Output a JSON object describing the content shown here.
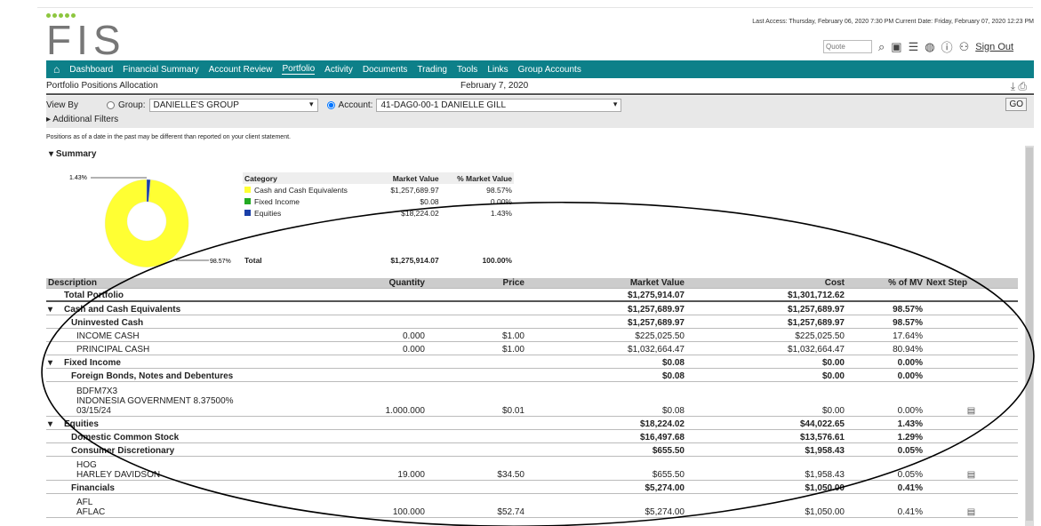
{
  "header": {
    "logo": "FIS",
    "last_access": "Last Access: Thursday, February 06, 2020 7:30 PM Current Date: Friday, February 07, 2020 12:23 PM",
    "quote_placeholder": "Quote",
    "sign_out": "Sign Out"
  },
  "nav": [
    "Dashboard",
    "Financial Summary",
    "Account Review",
    "Portfolio",
    "Activity",
    "Documents",
    "Trading",
    "Tools",
    "Links",
    "Group Accounts"
  ],
  "nav_active": "Portfolio",
  "page": {
    "title": "Portfolio Positions Allocation",
    "date": "February 7, 2020"
  },
  "filters": {
    "view_by": "View By",
    "group_label": "Group:",
    "group_value": "DANIELLE'S GROUP",
    "account_label": "Account:",
    "account_value": "41-DAG0-00-1 DANIELLE GILL",
    "go": "GO",
    "additional": "Additional Filters",
    "selected": "account"
  },
  "note": "Positions as of a date in the past may be different than reported on your client statement.",
  "summary": {
    "title": "Summary",
    "label_small": "1.43%",
    "label_large": "98.57%",
    "headers": [
      "Category",
      "Market Value",
      "% Market Value"
    ],
    "rows": [
      {
        "name": "Cash and Cash Equivalents",
        "mv": "$1,257,689.97",
        "pct": "98.57%",
        "color": "#ffff33"
      },
      {
        "name": "Fixed Income",
        "mv": "$0.08",
        "pct": "0.00%",
        "color": "#22aa22"
      },
      {
        "name": "Equities",
        "mv": "$18,224.02",
        "pct": "1.43%",
        "color": "#1a3fa8"
      }
    ],
    "total": {
      "label": "Total",
      "mv": "$1,275,914.07",
      "pct": "100.00%"
    }
  },
  "chart_data": {
    "type": "pie",
    "categories": [
      "Cash and Cash Equivalents",
      "Fixed Income",
      "Equities"
    ],
    "values": [
      98.57,
      0.0,
      1.43
    ],
    "colors": [
      "#ffff33",
      "#22aa22",
      "#1a3fa8"
    ]
  },
  "table": {
    "headers": [
      "Description",
      "Quantity",
      "Price",
      "Market Value",
      "Cost",
      "% of MV",
      "Next Step"
    ],
    "rows": [
      {
        "desc": "Total Portfolio",
        "qty": "",
        "price": "",
        "mv": "$1,275,914.07",
        "cost": "$1,301,712.62",
        "pct": "",
        "level": 0,
        "bold": true
      },
      {
        "desc": "Cash and Cash Equivalents",
        "qty": "",
        "price": "",
        "mv": "$1,257,689.97",
        "cost": "$1,257,689.97",
        "pct": "98.57%",
        "level": 0,
        "bold": true,
        "toggle": true
      },
      {
        "desc": "Uninvested Cash",
        "qty": "",
        "price": "",
        "mv": "$1,257,689.97",
        "cost": "$1,257,689.97",
        "pct": "98.57%",
        "level": 1,
        "bold": true
      },
      {
        "desc": "INCOME CASH",
        "qty": "0.000",
        "price": "$1.00",
        "mv": "$225,025.50",
        "cost": "$225,025.50",
        "pct": "17.64%",
        "level": 2
      },
      {
        "desc": "PRINCIPAL CASH",
        "qty": "0.000",
        "price": "$1.00",
        "mv": "$1,032,664.47",
        "cost": "$1,032,664.47",
        "pct": "80.94%",
        "level": 2
      },
      {
        "desc": "Fixed Income",
        "qty": "",
        "price": "",
        "mv": "$0.08",
        "cost": "$0.00",
        "pct": "0.00%",
        "level": 0,
        "bold": true,
        "toggle": true
      },
      {
        "desc": "Foreign Bonds, Notes and Debentures",
        "qty": "",
        "price": "",
        "mv": "$0.08",
        "cost": "$0.00",
        "pct": "0.00%",
        "level": 1,
        "bold": true
      },
      {
        "symbol": "BDFM7X3",
        "desc": "INDONESIA GOVERNMENT 8.37500% 03/15/24",
        "qty": "1.000.000",
        "price": "$0.01",
        "mv": "$0.08",
        "cost": "$0.00",
        "pct": "0.00%",
        "level": 2,
        "next": true,
        "tall": 3
      },
      {
        "desc": "Equities",
        "qty": "",
        "price": "",
        "mv": "$18,224.02",
        "cost": "$44,022.65",
        "pct": "1.43%",
        "level": 0,
        "bold": true,
        "toggle": true
      },
      {
        "desc": "Domestic Common Stock",
        "qty": "",
        "price": "",
        "mv": "$16,497.68",
        "cost": "$13,576.61",
        "pct": "1.29%",
        "level": 1,
        "bold": true
      },
      {
        "desc": "Consumer Discretionary",
        "qty": "",
        "price": "",
        "mv": "$655.50",
        "cost": "$1,958.43",
        "pct": "0.05%",
        "level": 1,
        "bold": true
      },
      {
        "symbol": "HOG",
        "link": true,
        "desc": "HARLEY DAVIDSON",
        "qty": "19.000",
        "price": "$34.50",
        "mv": "$655.50",
        "cost": "$1,958.43",
        "pct": "0.05%",
        "level": 2,
        "next": true,
        "tall": 2
      },
      {
        "desc": "Financials",
        "qty": "",
        "price": "",
        "mv": "$5,274.00",
        "cost": "$1,050.00",
        "pct": "0.41%",
        "level": 1,
        "bold": true
      },
      {
        "symbol": "AFL",
        "link": true,
        "desc": "AFLAC",
        "qty": "100.000",
        "price": "$52.74",
        "mv": "$5,274.00",
        "cost": "$1,050.00",
        "pct": "0.41%",
        "level": 2,
        "next": true,
        "tall": 2
      }
    ]
  }
}
